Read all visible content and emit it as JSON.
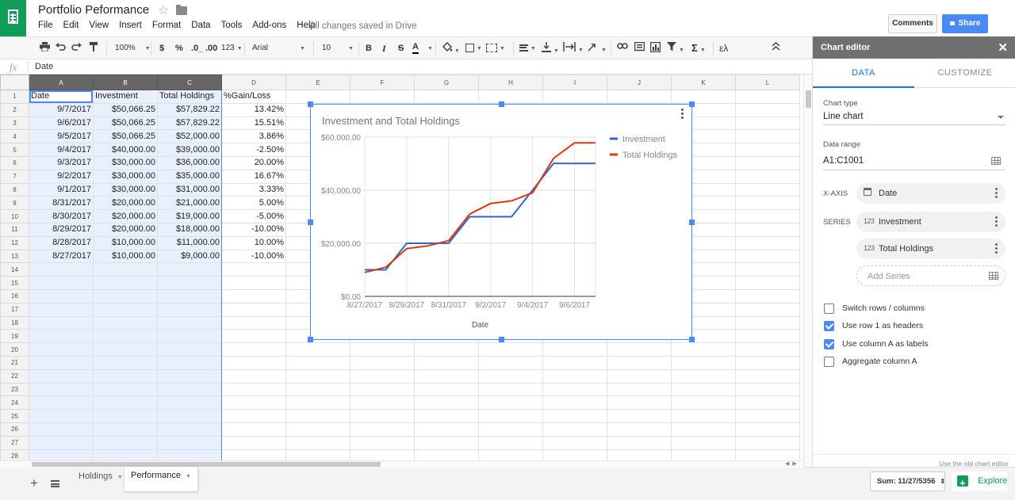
{
  "header": {
    "doc_title": "Portfolio Peformance",
    "menu": [
      "File",
      "Edit",
      "View",
      "Insert",
      "Format",
      "Data",
      "Tools",
      "Add-ons",
      "Help"
    ],
    "save_status": "All changes saved in Drive",
    "comments_label": "Comments",
    "share_label": "Share"
  },
  "toolbar": {
    "zoom": "100%",
    "currency": "$",
    "percent": "%",
    "decrease_decimals": ".0_",
    "increase_decimals": ".00",
    "more_formats": "123",
    "font": "Arial",
    "font_size": "10",
    "bold": "B",
    "italic": "I",
    "strikethrough": "S",
    "text_color": "A",
    "functions": "Σ",
    "input_tools": "ελ"
  },
  "formula_bar": {
    "fx": "fx",
    "value": "Date"
  },
  "grid": {
    "columns": [
      "A",
      "B",
      "C",
      "D",
      "E",
      "F",
      "G",
      "H",
      "I",
      "J",
      "K",
      "L"
    ],
    "rows": [
      [
        "Date",
        "Investment",
        "Total Holdings",
        "%Gain/Loss"
      ],
      [
        "9/7/2017",
        "$50,066.25",
        "$57,829.22",
        "13.42%"
      ],
      [
        "9/6/2017",
        "$50,066.25",
        "$57,829.22",
        "15.51%"
      ],
      [
        "9/5/2017",
        "$50,066.25",
        "$52,000.00",
        "3.86%"
      ],
      [
        "9/4/2017",
        "$40,000.00",
        "$39,000.00",
        "-2.50%"
      ],
      [
        "9/3/2017",
        "$30,000.00",
        "$36,000.00",
        "20.00%"
      ],
      [
        "9/2/2017",
        "$30,000.00",
        "$35,000.00",
        "16.67%"
      ],
      [
        "9/1/2017",
        "$30,000.00",
        "$31,000.00",
        "3.33%"
      ],
      [
        "8/31/2017",
        "$20,000.00",
        "$21,000.00",
        "5.00%"
      ],
      [
        "8/30/2017",
        "$20,000.00",
        "$19,000.00",
        "-5.00%"
      ],
      [
        "8/29/2017",
        "$20,000.00",
        "$18,000.00",
        "-10.00%"
      ],
      [
        "8/28/2017",
        "$10,000.00",
        "$11,000.00",
        "10.00%"
      ],
      [
        "8/27/2017",
        "$10,000.00",
        "$9,000.00",
        "-10.00%"
      ]
    ],
    "row_count": 28
  },
  "chart_data": {
    "type": "line",
    "title": "Investment and Total Holdings",
    "xlabel": "Date",
    "ylabel": "",
    "x": [
      "8/27/2017",
      "8/28/2017",
      "8/29/2017",
      "8/30/2017",
      "8/31/2017",
      "9/1/2017",
      "9/2/2017",
      "9/3/2017",
      "9/4/2017",
      "9/5/2017",
      "9/6/2017",
      "9/7/2017"
    ],
    "x_tick_labels": [
      "8/27/2017",
      "8/29/2017",
      "8/31/2017",
      "9/2/2017",
      "9/4/2017",
      "9/6/2017"
    ],
    "y_tick_labels": [
      "$0.00",
      "$20,000.00",
      "$40,000.00",
      "$60,000.00"
    ],
    "ylim": [
      0,
      60000
    ],
    "grid": true,
    "legend": "right",
    "series": [
      {
        "name": "Investment",
        "color": "#3366cc",
        "values": [
          10000,
          10000,
          20000,
          20000,
          20000,
          30000,
          30000,
          30000,
          40000,
          50066.25,
          50066.25,
          50066.25
        ]
      },
      {
        "name": "Total Holdings",
        "color": "#dc3912",
        "values": [
          9000,
          11000,
          18000,
          19000,
          21000,
          31000,
          35000,
          36000,
          39000,
          52000,
          57829.22,
          57829.22
        ]
      }
    ]
  },
  "editor": {
    "title": "Chart editor",
    "tabs": [
      "DATA",
      "CUSTOMIZE"
    ],
    "chart_type_label": "Chart type",
    "chart_type_value": "Line chart",
    "data_range_label": "Data range",
    "data_range_value": "A1:C1001",
    "xaxis_label": "X-AXIS",
    "xaxis_value": "Date",
    "series_label": "SERIES",
    "series": [
      "Investment",
      "Total Holdings"
    ],
    "series_icon_text": "123",
    "add_series": "Add Series",
    "checkboxes": [
      {
        "label": "Switch rows / columns",
        "checked": false
      },
      {
        "label": "Use row 1 as headers",
        "checked": true
      },
      {
        "label": "Use column A as labels",
        "checked": true
      },
      {
        "label": "Aggregate column A",
        "checked": false
      }
    ],
    "old_editor_link": "Use the old chart editor"
  },
  "bottom": {
    "sheets": [
      "Holdings",
      "Performance"
    ],
    "active_sheet": "Performance",
    "sum": "Sum: 11/27/5356",
    "explore": "Explore"
  },
  "colors": {
    "brand": "#0f9d58",
    "accent": "#4a8af4",
    "investment_line": "#3366cc",
    "holdings_line": "#dc3912"
  }
}
